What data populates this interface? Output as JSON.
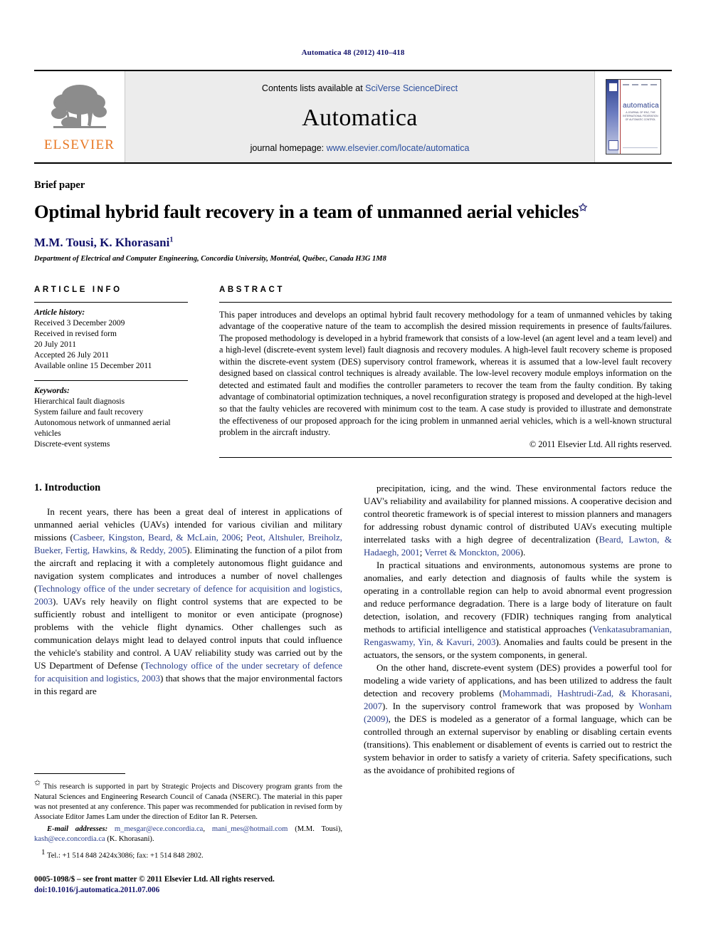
{
  "running_head": "Automatica 48 (2012) 410–418",
  "masthead": {
    "publisher_logo_name": "ELSEVIER",
    "contents_prefix": "Contents lists available at ",
    "contents_link": "SciVerse ScienceDirect",
    "journal_name": "Automatica",
    "homepage_prefix": "journal homepage: ",
    "homepage_url": "www.elsevier.com/locate/automatica",
    "cover": {
      "title": "automatica",
      "subtitle": "A JOURNAL OF IFAC, THE INTERNATIONAL FEDERATION OF AUTOMATIC CONTROL",
      "ifac_mark": "IFAC"
    },
    "link_color": "#2c4f9e",
    "panel_color": "#ececec",
    "elsevier_orange": "#e87722"
  },
  "article": {
    "doctype": "Brief paper",
    "title": "Optimal hybrid fault recovery in a team of unmanned aerial vehicles",
    "title_footnote_marker": "✩",
    "authors": "M.M. Tousi, K. Khorasani",
    "author_footnote_marker": "1",
    "affiliation": "Department of Electrical and Computer Engineering, Concordia University, Montréal, Québec, Canada H3G 1M8"
  },
  "info": {
    "label": "ARTICLE INFO",
    "history_head": "Article history:",
    "history_lines": "Received 3 December 2009\nReceived in revised form\n20 July 2011\nAccepted 26 July 2011\nAvailable online 15 December 2011",
    "keywords_head": "Keywords:",
    "keywords_lines": "Hierarchical fault diagnosis\nSystem failure and fault recovery\nAutonomous network of unmanned aerial\n   vehicles\nDiscrete-event systems"
  },
  "abstract": {
    "label": "ABSTRACT",
    "text": "This paper introduces and develops an optimal hybrid fault recovery methodology for a team of unmanned vehicles by taking advantage of the cooperative nature of the team to accomplish the desired mission requirements in presence of faults/failures. The proposed methodology is developed in a hybrid framework that consists of a low-level (an agent level and a team level) and a high-level (discrete-event system level) fault diagnosis and recovery modules. A high-level fault recovery scheme is proposed within the discrete-event system (DES) supervisory control framework, whereas it is assumed that a low-level fault recovery designed based on classical control techniques is already available. The low-level recovery module employs information on the detected and estimated fault and modifies the controller parameters to recover the team from the faulty condition. By taking advantage of combinatorial optimization techniques, a novel reconfiguration strategy is proposed and developed at the high-level so that the faulty vehicles are recovered with minimum cost to the team. A case study is provided to illustrate and demonstrate the effectiveness of our proposed approach for the icing problem in unmanned aerial vehicles, which is a well-known structural problem in the aircraft industry.",
    "copyright": "© 2011 Elsevier Ltd. All rights reserved."
  },
  "body": {
    "section_heading": "1. Introduction",
    "left_paragraphs": [
      {
        "runs": [
          {
            "t": "In recent years, there has been a great deal of interest in applications of unmanned aerial vehicles (UAVs) intended for various civilian and military missions (",
            "c": false
          },
          {
            "t": "Casbeer, Kingston, Beard, & McLain, 2006",
            "c": true
          },
          {
            "t": "; ",
            "c": false
          },
          {
            "t": "Peot, Altshuler, Breiholz, Bueker, Fertig, Hawkins, & Reddy, 2005",
            "c": true
          },
          {
            "t": "). Eliminating the function of a pilot from the aircraft and replacing it with a completely autonomous flight guidance and navigation system complicates and introduces a number of novel challenges (",
            "c": false
          },
          {
            "t": "Technology office of the under secretary of defence for acquisition and logistics, 2003",
            "c": true
          },
          {
            "t": "). UAVs rely heavily on flight control systems that are expected to be sufficiently robust and intelligent to monitor or even anticipate (prognose) problems with the vehicle flight dynamics. Other challenges such as communication delays might lead to delayed control inputs that could influence the vehicle's stability and control. A UAV reliability study was carried out by the US Department of Defense (",
            "c": false
          },
          {
            "t": "Technology office of the under secretary of defence for acquisition and logistics, 2003",
            "c": true
          },
          {
            "t": ") that shows that the major environmental factors in this regard are",
            "c": false
          }
        ]
      }
    ],
    "right_paragraphs": [
      {
        "runs": [
          {
            "t": "precipitation, icing, and the wind. These environmental factors reduce the UAV's reliability and availability for planned missions. A cooperative decision and control theoretic framework is of special interest to mission planners and managers for addressing robust dynamic control of distributed UAVs executing multiple interrelated tasks with a high degree of decentralization (",
            "c": false
          },
          {
            "t": "Beard, Lawton, & Hadaegh, 2001",
            "c": true
          },
          {
            "t": "; ",
            "c": false
          },
          {
            "t": "Verret & Monckton, 2006",
            "c": true
          },
          {
            "t": ").",
            "c": false
          }
        ]
      },
      {
        "runs": [
          {
            "t": "In practical situations and environments, autonomous systems are prone to anomalies, and early detection and diagnosis of faults while the system is operating in a controllable region can help to avoid abnormal event progression and reduce performance degradation. There is a large body of literature on fault detection, isolation, and recovery (FDIR) techniques ranging from analytical methods to artificial intelligence and statistical approaches (",
            "c": false
          },
          {
            "t": "Venkatasubramanian, Rengaswamy, Yin, & Kavuri, 2003",
            "c": true
          },
          {
            "t": "). Anomalies and faults could be present in the actuators, the sensors, or the system components, in general.",
            "c": false
          }
        ]
      },
      {
        "runs": [
          {
            "t": "On the other hand, discrete-event system (DES) provides a powerful tool for modeling a wide variety of applications, and has been utilized to address the fault detection and recovery problems (",
            "c": false
          },
          {
            "t": "Mohammadi, Hashtrudi-Zad, & Khorasani, 2007",
            "c": true
          },
          {
            "t": "). In the supervisory control framework that was proposed by ",
            "c": false
          },
          {
            "t": "Wonham (2009)",
            "c": true
          },
          {
            "t": ", the DES is modeled as a generator of a formal language, which can be controlled through an external supervisor by enabling or disabling certain events (transitions). This enablement or disablement of events is carried out to restrict the system behavior in order to satisfy a variety of criteria. Safety specifications, such as the avoidance of prohibited regions of",
            "c": false
          }
        ]
      }
    ]
  },
  "footnotes": {
    "star_marker": "✩",
    "star_text": "This research is supported in part by Strategic Projects and Discovery program grants from the Natural Sciences and Engineering Research Council of Canada (NSERC). The material in this paper was not presented at any conference. This paper was recommended for publication in revised form by Associate Editor James Lam under the direction of Editor Ian R. Petersen.",
    "email_label": "E-mail addresses:",
    "email_1": "m_mesgar@ece.concordia.ca",
    "email_2": "mani_mes@hotmail.com",
    "email_attrib_1": "(M.M. Tousi),",
    "email_3": "kash@ece.concordia.ca",
    "email_attrib_2": "(K. Khorasani).",
    "tel_marker": "1",
    "tel_text": "Tel.: +1 514 848 2424x3086; fax: +1 514 848 2802."
  },
  "imprint": {
    "issn_line": "0005-1098/$ – see front matter © 2011 Elsevier Ltd. All rights reserved.",
    "doi_line": "doi:10.1016/j.automatica.2011.07.006"
  }
}
